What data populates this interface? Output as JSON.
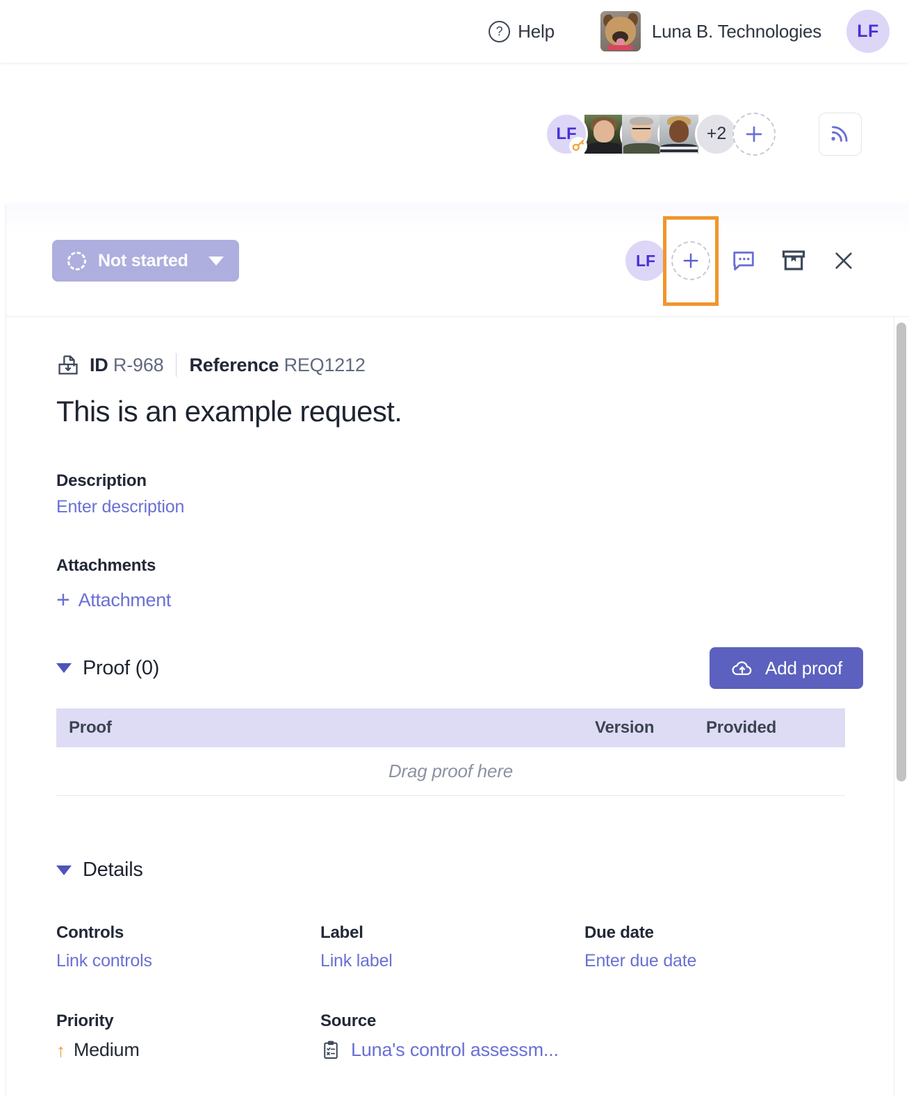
{
  "topbar": {
    "help_label": "Help",
    "help_icon": "question-circle-icon",
    "org_name": "Luna B. Technologies",
    "org_logo_alt": "dog-photo-logo",
    "user_initials": "LF"
  },
  "memberbar": {
    "owner_initials": "LF",
    "owner_badge_icon": "key-icon",
    "members": [
      {
        "name": "member-photo-1"
      },
      {
        "name": "member-photo-2"
      },
      {
        "name": "member-photo-3"
      }
    ],
    "overflow_count": "+2",
    "add_member_label": "+",
    "feed_icon": "rss-feed-icon"
  },
  "panel": {
    "toolbar": {
      "status_label": "Not started",
      "status_icon": "dashed-circle-icon",
      "status_caret_icon": "chevron-down-icon",
      "assignee_initials": "LF",
      "add_assignee_label": "+",
      "comment_icon": "comment-bubble-icon",
      "archive_icon": "archive-box-icon",
      "close_icon": "close-x-icon",
      "highlight_color": "#f0962e"
    },
    "meta": {
      "inbox_icon": "inbox-download-icon",
      "id_label": "ID",
      "id_value": "R-968",
      "reference_label": "Reference",
      "reference_value": "REQ1212"
    },
    "title": "This is an example request.",
    "description": {
      "label": "Description",
      "placeholder_link": "Enter description"
    },
    "attachments": {
      "label": "Attachments",
      "add_label": "Attachment",
      "add_icon": "plus-icon"
    },
    "proof": {
      "section_title": "Proof (0)",
      "collapse_icon": "triangle-down-icon",
      "add_button_label": "Add proof",
      "add_button_icon": "cloud-upload-icon",
      "columns": [
        "Proof",
        "Version",
        "Provided"
      ],
      "empty_text": "Drag proof here",
      "rows": []
    },
    "details": {
      "section_title": "Details",
      "collapse_icon": "triangle-down-icon",
      "fields": [
        {
          "label": "Controls",
          "value": "Link controls",
          "type": "link"
        },
        {
          "label": "Label",
          "value": "Link label",
          "type": "link"
        },
        {
          "label": "Due date",
          "value": "Enter due date",
          "type": "link"
        },
        {
          "label": "Priority",
          "value": "Medium",
          "type": "priority",
          "icon": "arrow-up-icon"
        },
        {
          "label": "Source",
          "value": "Luna's control assessm...",
          "type": "source-link",
          "icon": "clipboard-checklist-icon"
        }
      ]
    }
  },
  "colors": {
    "accent_purple": "#5c61bf",
    "link_purple": "#6a70d4",
    "status_pill": "#aeaedf",
    "table_header": "#dedcf4",
    "highlight_orange": "#f0962e",
    "avatar_bg": "#ddd6f7",
    "avatar_text": "#4632d6"
  }
}
